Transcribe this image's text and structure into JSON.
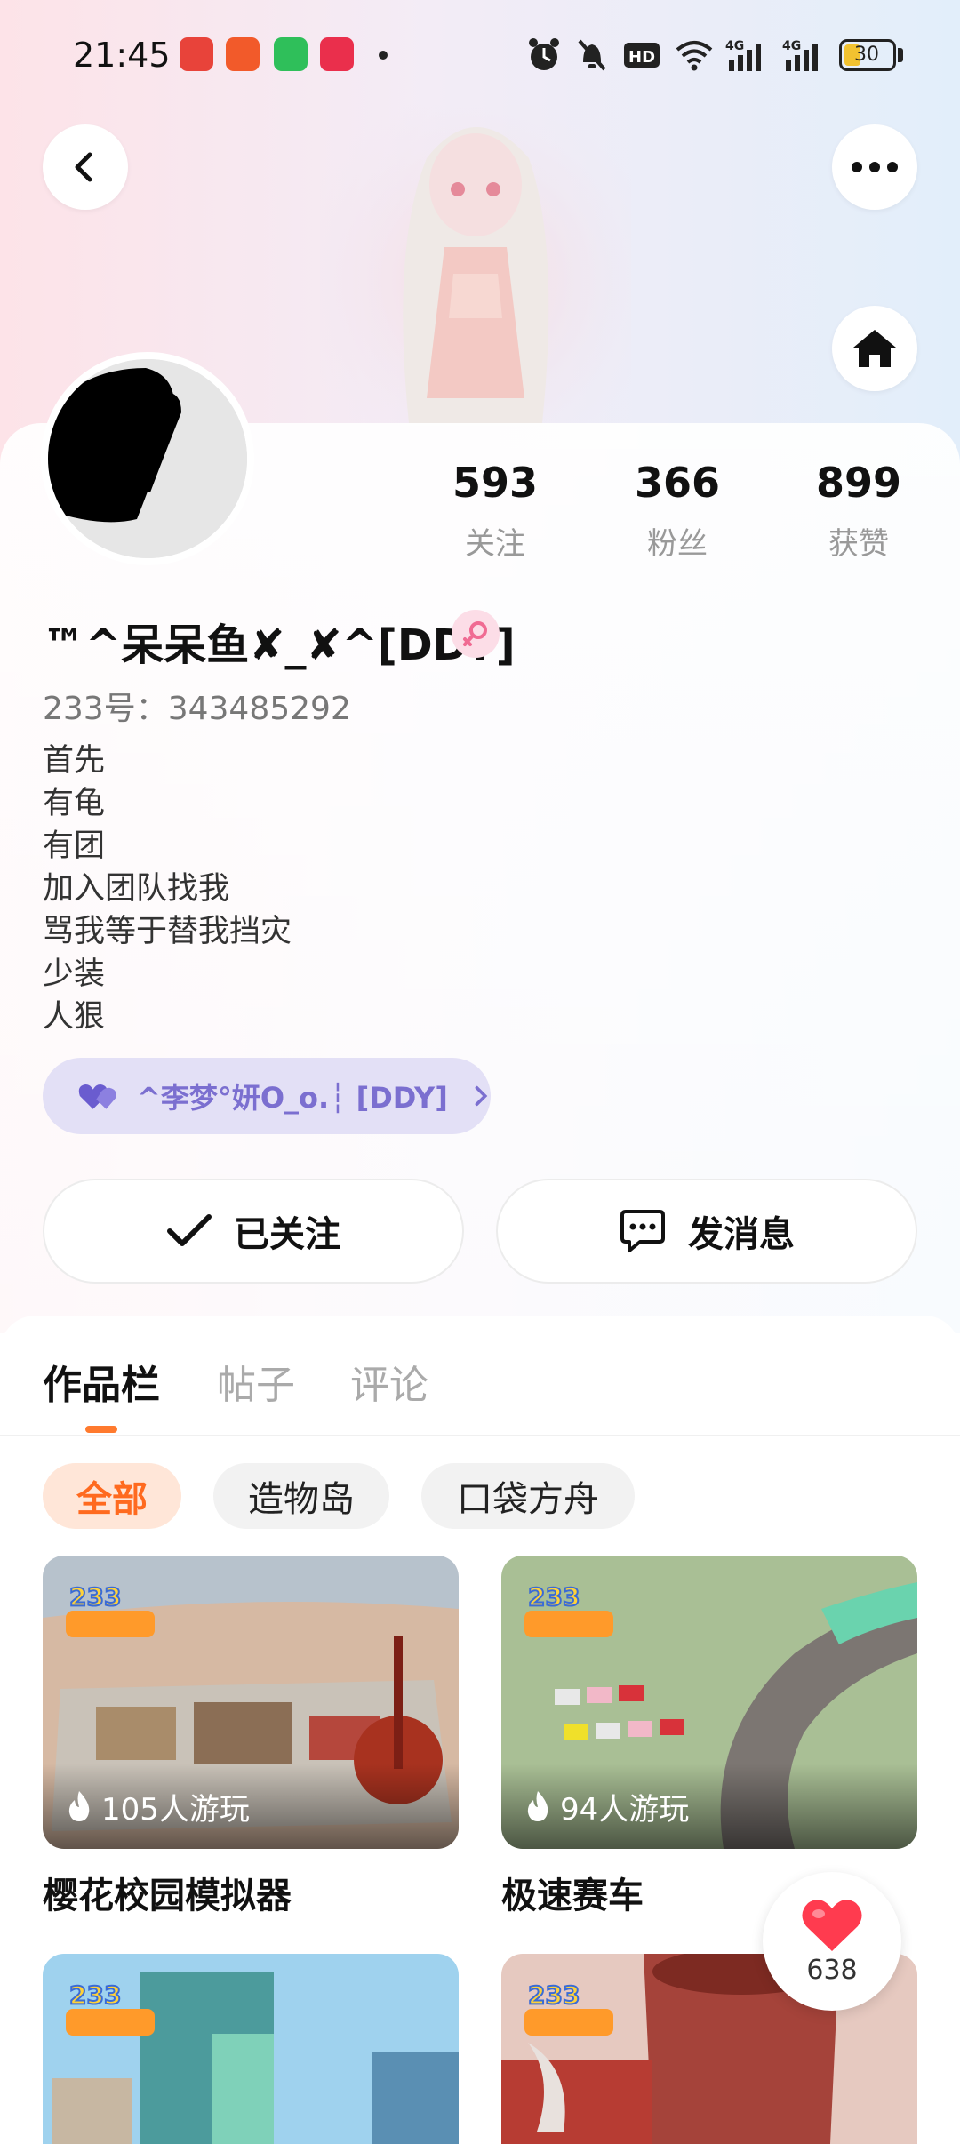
{
  "status_bar": {
    "time": "21:45",
    "battery": "30",
    "icons": [
      "alarm-icon",
      "mute-icon",
      "hd-icon",
      "wifi-icon",
      "signal-4g-icon",
      "signal-4g-icon",
      "battery-icon"
    ]
  },
  "header": {
    "back_icon": "chevron-left-icon",
    "more_icon": "more-horizontal-icon",
    "home_icon": "home-icon"
  },
  "profile": {
    "stats": [
      {
        "value": "593",
        "label": "关注"
      },
      {
        "value": "366",
        "label": "粉丝"
      },
      {
        "value": "899",
        "label": "获赞"
      }
    ],
    "username": "™^呆呆鱼✘_✘^[DDY]",
    "uid": "233号：343485292",
    "bio": [
      "首先",
      "有龟",
      "有团",
      "加入团队找我",
      "骂我等于替我挡灾",
      "少装",
      "人狠"
    ],
    "team": "^李梦°妍O_o.┆ [DDY]",
    "follow_button": "已关注",
    "message_button": "发消息"
  },
  "tabs": [
    {
      "label": "作品栏",
      "active": true
    },
    {
      "label": "帖子",
      "active": false
    },
    {
      "label": "评论",
      "active": false
    }
  ],
  "filters": [
    {
      "label": "全部",
      "active": true
    },
    {
      "label": "造物岛",
      "active": false
    },
    {
      "label": "口袋方舟",
      "active": false
    }
  ],
  "games": [
    {
      "title": "樱花校园模拟器",
      "players": "105人游玩",
      "badge": "233造物岛"
    },
    {
      "title": "极速赛车",
      "players": "94人游玩",
      "badge": "233造物岛"
    },
    {
      "title": "",
      "players": "",
      "badge": "233造物岛"
    },
    {
      "title": "",
      "players": "",
      "badge": "233造物岛"
    }
  ],
  "like_fab": {
    "count": "638"
  },
  "colors": {
    "accent": "#ff6a1f",
    "team_purple": "#7b6fd0",
    "heart": "#ff3b4f"
  }
}
